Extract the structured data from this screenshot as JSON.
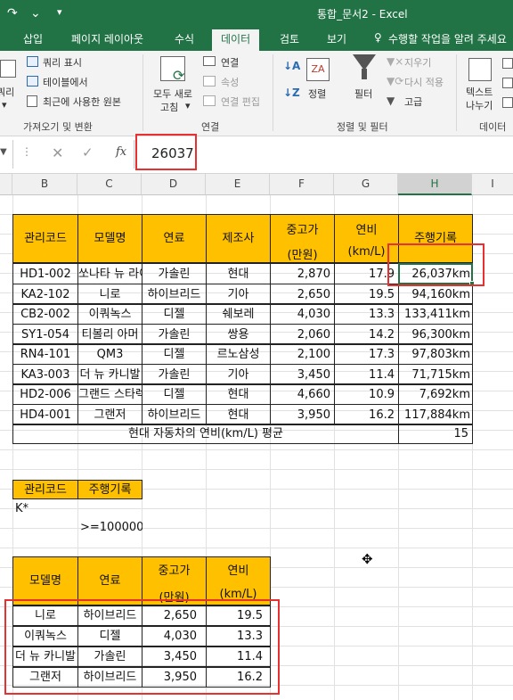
{
  "window": {
    "title": "통합_문서2 - Excel"
  },
  "tabs": [
    "삽입",
    "페이지 레이아웃",
    "수식",
    "데이터",
    "검토",
    "보기"
  ],
  "tell_me": "수행할 작업을 알려 주세요",
  "ribbon": {
    "get_data": {
      "query_show": "쿼리 표시",
      "from_table": "테이블에서",
      "recent_sources": "최근에 사용한 원본",
      "new_query": "새 쿼리",
      "partial_left": "쿼리",
      "group": "가져오기 및 변환"
    },
    "connections": {
      "refresh_all": "모두 새로",
      "refresh_all2": "고침",
      "connections": "연결",
      "properties": "속성",
      "edit_links": "연결 편집",
      "group": "연결"
    },
    "sort_filter": {
      "sort": "정렬",
      "filter": "필터",
      "clear": "지우기",
      "reapply": "다시 적용",
      "advanced": "고급",
      "group": "정렬 및 필터"
    },
    "data_tools": {
      "text_to_columns": "텍스트",
      "text_to_columns2": "나누기",
      "group": "데이터"
    }
  },
  "formula_bar": {
    "value": "26037",
    "fx": "fx"
  },
  "columns": [
    "B",
    "C",
    "D",
    "E",
    "F",
    "G",
    "H",
    "I"
  ],
  "table1": {
    "headers": [
      "관리코드",
      "모델명",
      "연료",
      "제조사",
      "중고가",
      "(만원)",
      "연비",
      "(km/L)",
      "주행기록"
    ],
    "rows": [
      [
        "HD1-002",
        "쏘나타 뉴 라이즈",
        "가솔린",
        "현대",
        "2,870",
        "17.9",
        "26,037km"
      ],
      [
        "KA2-102",
        "니로",
        "하이브리드",
        "기아",
        "2,650",
        "19.5",
        "94,160km"
      ],
      [
        "CB2-002",
        "이쿼녹스",
        "디젤",
        "쉐보레",
        "4,030",
        "13.3",
        "133,411km"
      ],
      [
        "SY1-054",
        "티볼리 아머",
        "가솔린",
        "쌍용",
        "2,060",
        "14.2",
        "96,300km"
      ],
      [
        "RN4-101",
        "QM3",
        "디젤",
        "르노삼성",
        "2,100",
        "17.3",
        "97,803km"
      ],
      [
        "KA3-003",
        "더 뉴 카니발",
        "가솔린",
        "기아",
        "3,450",
        "11.4",
        "71,715km"
      ],
      [
        "HD2-006",
        "그랜드 스타렉스",
        "디젤",
        "현대",
        "4,660",
        "10.9",
        "7,692km"
      ],
      [
        "HD4-001",
        "그랜저",
        "하이브리드",
        "현대",
        "3,950",
        "16.2",
        "117,884km"
      ]
    ],
    "avg_label": "현대 자동차의 연비(km/L) 평균",
    "avg_value": "15"
  },
  "criteria": {
    "headers": [
      "관리코드",
      "주행기록"
    ],
    "row1": "K*",
    "row2": ">=100000"
  },
  "table2": {
    "headers": [
      "모델명",
      "연료",
      "중고가",
      "(만원)",
      "연비",
      "(km/L)"
    ],
    "rows": [
      [
        "니로",
        "하이브리드",
        "2,650",
        "19.5"
      ],
      [
        "이쿼녹스",
        "디젤",
        "4,030",
        "13.3"
      ],
      [
        "더 뉴 카니발",
        "가솔린",
        "3,450",
        "11.4"
      ],
      [
        "그랜저",
        "하이브리드",
        "3,950",
        "16.2"
      ]
    ]
  },
  "colors": {
    "excel_green": "#217346",
    "header_fill": "#ffc000",
    "highlight": "#e83030"
  }
}
